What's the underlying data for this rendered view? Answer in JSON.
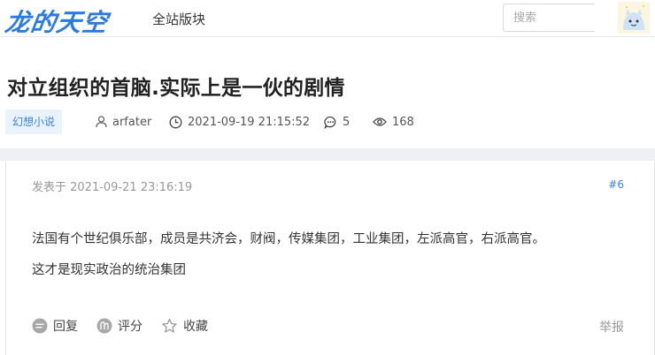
{
  "header": {
    "logo": "龙的天空",
    "nav_item": "全站版块",
    "search_placeholder": "搜索"
  },
  "thread": {
    "title": "对立组织的首脑.实际上是一伙的剧情",
    "tag": "幻想小说",
    "author": "arfater",
    "datetime": "2021-09-19 21:15:52",
    "replies": "5",
    "views": "168"
  },
  "post": {
    "posted_at": "发表于 2021-09-21 23:16:19",
    "floor": "#6",
    "lines": [
      "法国有个世纪俱乐部，成员是共济会，财阀，传媒集团，工业集团，左派高官，右派高官。",
      "这才是现实政治的统治集团"
    ],
    "actions": {
      "reply": "回复",
      "rate": "评分",
      "favorite": "收藏",
      "report": "举报"
    }
  },
  "colors": {
    "brand": "#2a7ae2",
    "tag_bg": "#eaf3fd",
    "tag_text": "#3b84d8",
    "separator": "#eef0f4"
  },
  "icons": {
    "author": "user-icon",
    "time": "clock-icon",
    "replies": "comment-icon",
    "views": "eye-icon",
    "reply": "reply-icon",
    "rate": "rate-icon",
    "favorite": "star-icon"
  }
}
